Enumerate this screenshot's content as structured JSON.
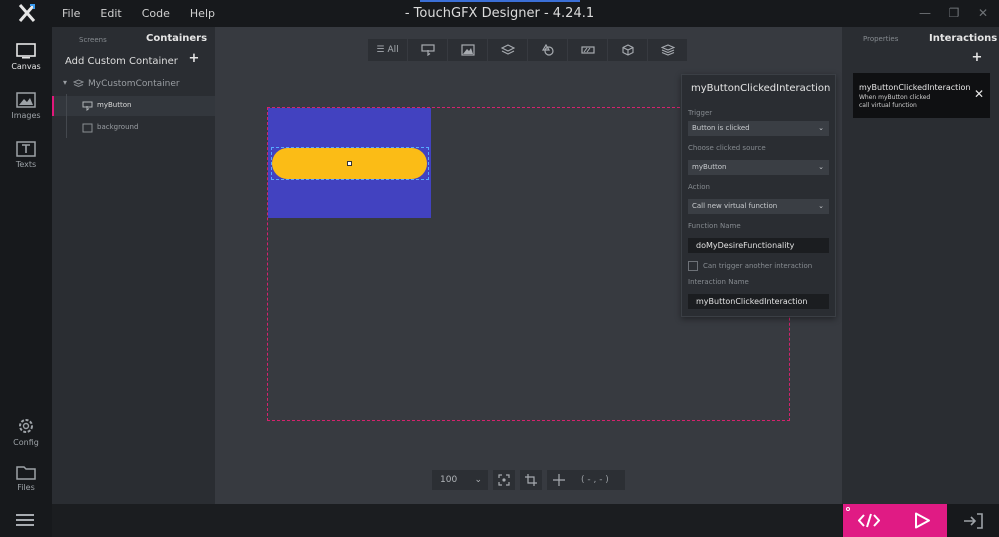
{
  "app": {
    "title": "- TouchGFX Designer - 4.24.1",
    "menu": [
      "File",
      "Edit",
      "Code",
      "Help"
    ]
  },
  "rail": {
    "items": [
      {
        "label": "Canvas",
        "icon": "canvas-icon"
      },
      {
        "label": "Images",
        "icon": "image-icon"
      },
      {
        "label": "Texts",
        "icon": "text-icon"
      },
      {
        "label": "Config",
        "icon": "gear-icon"
      },
      {
        "label": "Files",
        "icon": "folder-icon"
      }
    ]
  },
  "tree": {
    "tab_screens": "Screens",
    "tab_containers": "Containers",
    "add_label": "Add Custom Container",
    "add_plus": "+",
    "items": [
      {
        "label": "MyCustomContainer",
        "icon": "container-icon"
      },
      {
        "label": "myButton",
        "icon": "button-icon"
      },
      {
        "label": "background",
        "icon": "box-icon"
      }
    ]
  },
  "toolbar": {
    "all_label": "All",
    "buttons": [
      "button-icon",
      "image-icon",
      "layers-icon",
      "shapes-icon",
      "progress-icon",
      "3d-icon",
      "stack-icon"
    ]
  },
  "bottom": {
    "zoom": "100",
    "coords": "( - , - )"
  },
  "editor": {
    "title": "myButtonClickedInteraction",
    "trigger_label": "Trigger",
    "trigger_value": "Button is clicked",
    "source_label": "Choose clicked source",
    "source_value": "myButton",
    "action_label": "Action",
    "action_value": "Call new virtual function",
    "function_label": "Function Name",
    "function_value": "doMyDesireFunctionality",
    "can_trigger_label": "Can trigger another interaction",
    "name_label": "Interaction Name",
    "name_value": "myButtonClickedInteraction"
  },
  "rpanel": {
    "tab_properties": "Properties",
    "tab_interactions": "Interactions",
    "add_plus": "+",
    "card": {
      "title": "myButtonClickedInteraction",
      "line1": "When myButton clicked",
      "line2": "call virtual function",
      "close": "✕"
    }
  },
  "colors": {
    "accent": "#e01b84",
    "container_fill": "#4242c0",
    "button_fill": "#fbbc16",
    "selection": "#57a9ff"
  }
}
